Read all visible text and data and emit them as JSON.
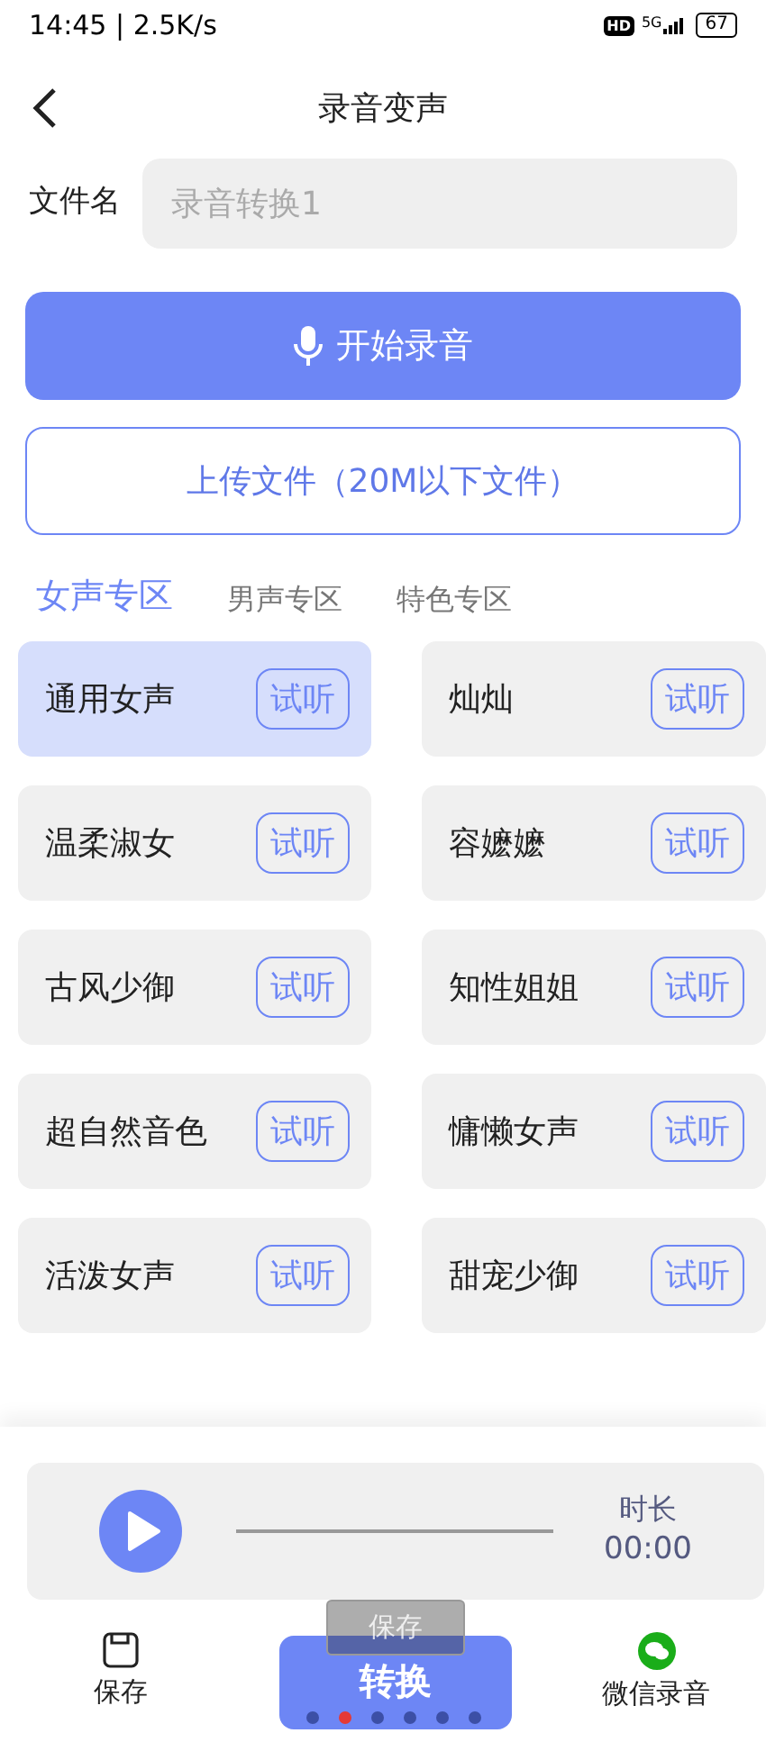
{
  "status_bar": {
    "time": "14:45 | 2.5K/s",
    "hd": "HD",
    "network": "5G",
    "battery": "67"
  },
  "header": {
    "title": "录音变声"
  },
  "file_name": {
    "label": "文件名",
    "placeholder": "录音转换1"
  },
  "record_button": {
    "label": "开始录音"
  },
  "upload_button": {
    "label": "上传文件（20M以下文件）"
  },
  "tabs": [
    {
      "label": "女声专区",
      "selected": true
    },
    {
      "label": "男声专区",
      "selected": false
    },
    {
      "label": "特色专区",
      "selected": false
    }
  ],
  "voices": [
    {
      "name": "通用女声",
      "preview": "试听",
      "selected": true
    },
    {
      "name": "灿灿",
      "preview": "试听",
      "selected": false
    },
    {
      "name": "温柔淑女",
      "preview": "试听",
      "selected": false
    },
    {
      "name": "容嬷嬷",
      "preview": "试听",
      "selected": false
    },
    {
      "name": "古风少御",
      "preview": "试听",
      "selected": false
    },
    {
      "name": "知性姐姐",
      "preview": "试听",
      "selected": false
    },
    {
      "name": "超自然音色",
      "preview": "试听",
      "selected": false
    },
    {
      "name": "慵懒女声",
      "preview": "试听",
      "selected": false
    },
    {
      "name": "活泼女声",
      "preview": "试听",
      "selected": false
    },
    {
      "name": "甜宠少御",
      "preview": "试听",
      "selected": false
    }
  ],
  "player": {
    "duration_label": "时长",
    "duration": "00:00"
  },
  "bottom_bar": {
    "save": "保存",
    "convert": "转换",
    "wechat": "微信录音"
  },
  "pager_dots": [
    {
      "selected": false
    },
    {
      "selected": true
    },
    {
      "selected": false
    },
    {
      "selected": false
    },
    {
      "selected": false
    },
    {
      "selected": false
    }
  ],
  "toast": {
    "text": "保存"
  }
}
